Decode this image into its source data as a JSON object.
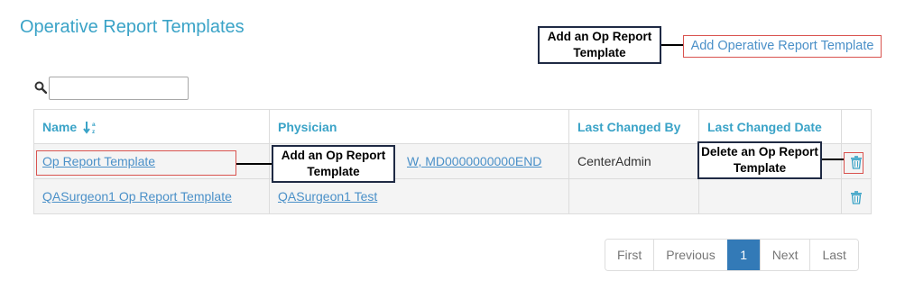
{
  "page": {
    "title": "Operative Report Templates"
  },
  "header": {
    "add_link": "Add Operative Report Template"
  },
  "search": {
    "value": "",
    "placeholder": ""
  },
  "table": {
    "columns": [
      "Name",
      "Physician",
      "Last Changed By",
      "Last Changed Date"
    ],
    "rows": [
      {
        "name": "Op Report Template",
        "physician": "W, MD0000000000END",
        "changed_by": "CenterAdmin",
        "changed_date": ""
      },
      {
        "name": "QASurgeon1 Op Report Template",
        "physician": "QASurgeon1 Test",
        "changed_by": "",
        "changed_date": ""
      }
    ]
  },
  "callouts": {
    "add_header": "Add an Op Report Template",
    "add_row": "Add an Op Report Template",
    "delete": "Delete an Op Report Template"
  },
  "pagination": {
    "first": "First",
    "previous": "Previous",
    "current": "1",
    "next": "Next",
    "last": "Last"
  },
  "icons": {
    "search": "search-icon",
    "sort": "sort-alpha-asc-icon",
    "delete": "trash-icon"
  },
  "colors": {
    "title": "#3aa3c7",
    "link": "#4a90c8",
    "highlight_border": "#d9534f",
    "callout_border": "#1f2a44",
    "active_page": "#337ab7"
  }
}
